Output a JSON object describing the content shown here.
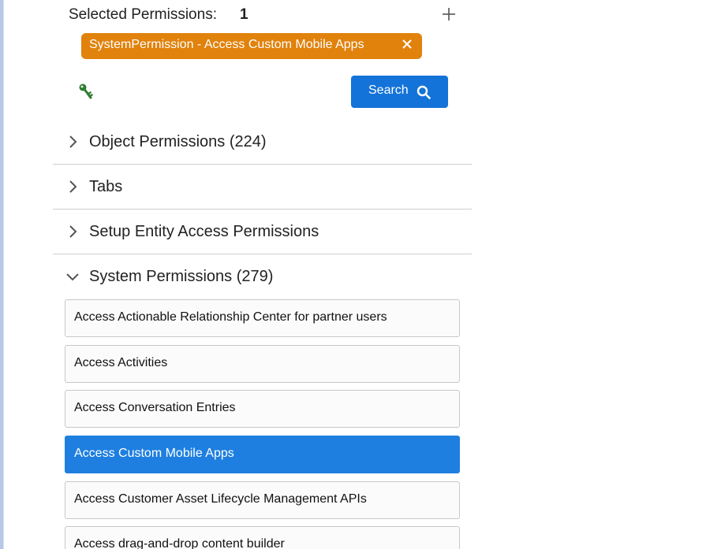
{
  "selected": {
    "label": "Selected Permissions:",
    "count": "1",
    "add_icon": "plus-icon",
    "chips": [
      {
        "label": "SystemPermission - Access Custom Mobile Apps",
        "close_icon": "close-icon"
      }
    ]
  },
  "toolbar": {
    "key_icon": "key-icon",
    "search_label": "Search",
    "search_icon": "search-icon"
  },
  "sections": [
    {
      "title": "Object Permissions (224)",
      "expanded": false
    },
    {
      "title": "Tabs",
      "expanded": false
    },
    {
      "title": "Setup Entity Access Permissions",
      "expanded": false
    },
    {
      "title": "System Permissions (279)",
      "expanded": true
    }
  ],
  "system_permissions": [
    {
      "label": "Access Actionable Relationship Center for partner users",
      "selected": false
    },
    {
      "label": "Access Activities",
      "selected": false
    },
    {
      "label": "Access Conversation Entries",
      "selected": false
    },
    {
      "label": "Access Custom Mobile Apps",
      "selected": true
    },
    {
      "label": "Access Customer Asset Lifecycle Management APIs",
      "selected": false
    },
    {
      "label": "Access drag-and-drop content builder",
      "selected": false
    }
  ],
  "colors": {
    "chip": "#e0820c",
    "primary": "#1473d9",
    "selected_row": "#1e7fe0",
    "key_icon": "#2e7d32"
  }
}
